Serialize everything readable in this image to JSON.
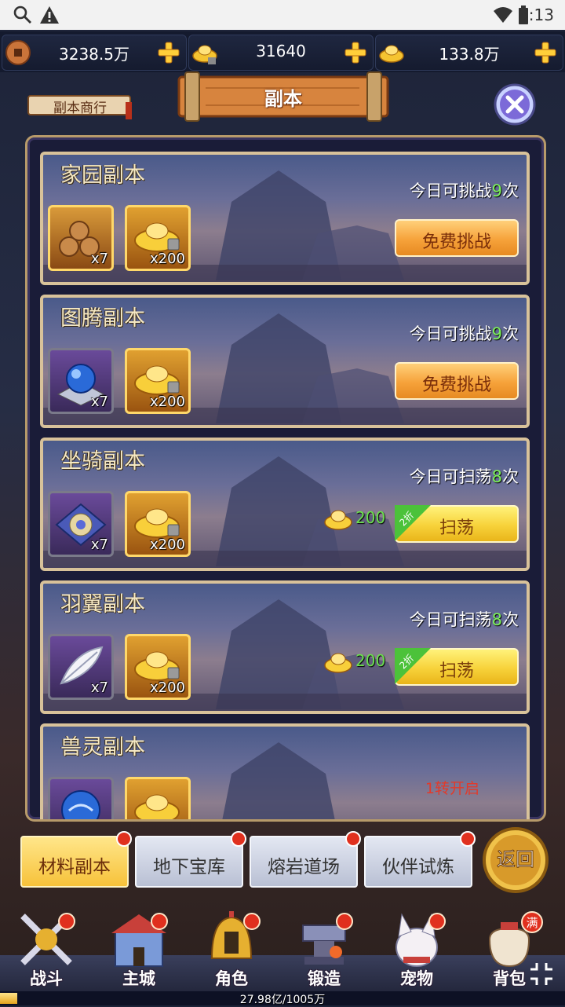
{
  "status": {
    "time": "3:13",
    "icons": [
      "search-icon",
      "warning-icon",
      "wifi-icon",
      "battery-icon"
    ]
  },
  "resources": [
    {
      "name": "copper-coin",
      "value": "3238.5万"
    },
    {
      "name": "locked-gold",
      "value": "31640"
    },
    {
      "name": "gold-ingot",
      "value": "133.8万"
    }
  ],
  "header": {
    "title": "副本",
    "shop_label": "副本商行"
  },
  "dungeons": [
    {
      "name": "家园副本",
      "count_prefix": "今日可挑战",
      "count": "9",
      "count_suffix": "次",
      "items": [
        {
          "icon": "wood-logs-icon",
          "qty": "x7"
        },
        {
          "icon": "locked-gold-ingot-icon",
          "qty": "x200"
        }
      ],
      "action": "免费挑战"
    },
    {
      "name": "图腾副本",
      "count_prefix": "今日可挑战",
      "count": "9",
      "count_suffix": "次",
      "items": [
        {
          "icon": "blue-orb-totem-icon",
          "qty": "x7"
        },
        {
          "icon": "locked-gold-ingot-icon",
          "qty": "x200"
        }
      ],
      "action": "免费挑战"
    },
    {
      "name": "坐骑副本",
      "count_prefix": "今日可扫荡",
      "count": "8",
      "count_suffix": "次",
      "items": [
        {
          "icon": "mount-stone-icon",
          "qty": "x7"
        },
        {
          "icon": "locked-gold-ingot-icon",
          "qty": "x200"
        }
      ],
      "cost": "200",
      "discount": "2折",
      "action": "扫荡"
    },
    {
      "name": "羽翼副本",
      "count_prefix": "今日可扫荡",
      "count": "8",
      "count_suffix": "次",
      "items": [
        {
          "icon": "feather-icon",
          "qty": "x7"
        },
        {
          "icon": "locked-gold-ingot-icon",
          "qty": "x200"
        }
      ],
      "cost": "200",
      "discount": "2折",
      "action": "扫荡"
    },
    {
      "name": "兽灵副本",
      "locked_text": "1转开启",
      "items": [
        {
          "icon": "beast-orb-icon"
        },
        {
          "icon": "locked-gold-ingot-icon"
        }
      ]
    }
  ],
  "tabs": [
    {
      "label": "材料副本",
      "active": true
    },
    {
      "label": "地下宝库",
      "active": false
    },
    {
      "label": "熔岩道场",
      "active": false
    },
    {
      "label": "伙伴试炼",
      "active": false
    }
  ],
  "back_label": "返回",
  "nav": [
    {
      "label": "战斗",
      "icon": "crossed-swords-icon"
    },
    {
      "label": "主城",
      "icon": "castle-icon"
    },
    {
      "label": "角色",
      "icon": "helmet-icon"
    },
    {
      "label": "锻造",
      "icon": "anvil-icon"
    },
    {
      "label": "宠物",
      "icon": "pet-cat-icon"
    },
    {
      "label": "背包",
      "icon": "bag-icon",
      "badge": "满"
    }
  ],
  "exp": {
    "text": "27.98亿/1005万",
    "fill": 0.03
  },
  "colors": {
    "count_green": "#7cf05a",
    "cost_green": "#6be04e",
    "locked_red": "#e23a2a",
    "button_orange": "#f6a23a",
    "button_yellow": "#f7d23a"
  }
}
